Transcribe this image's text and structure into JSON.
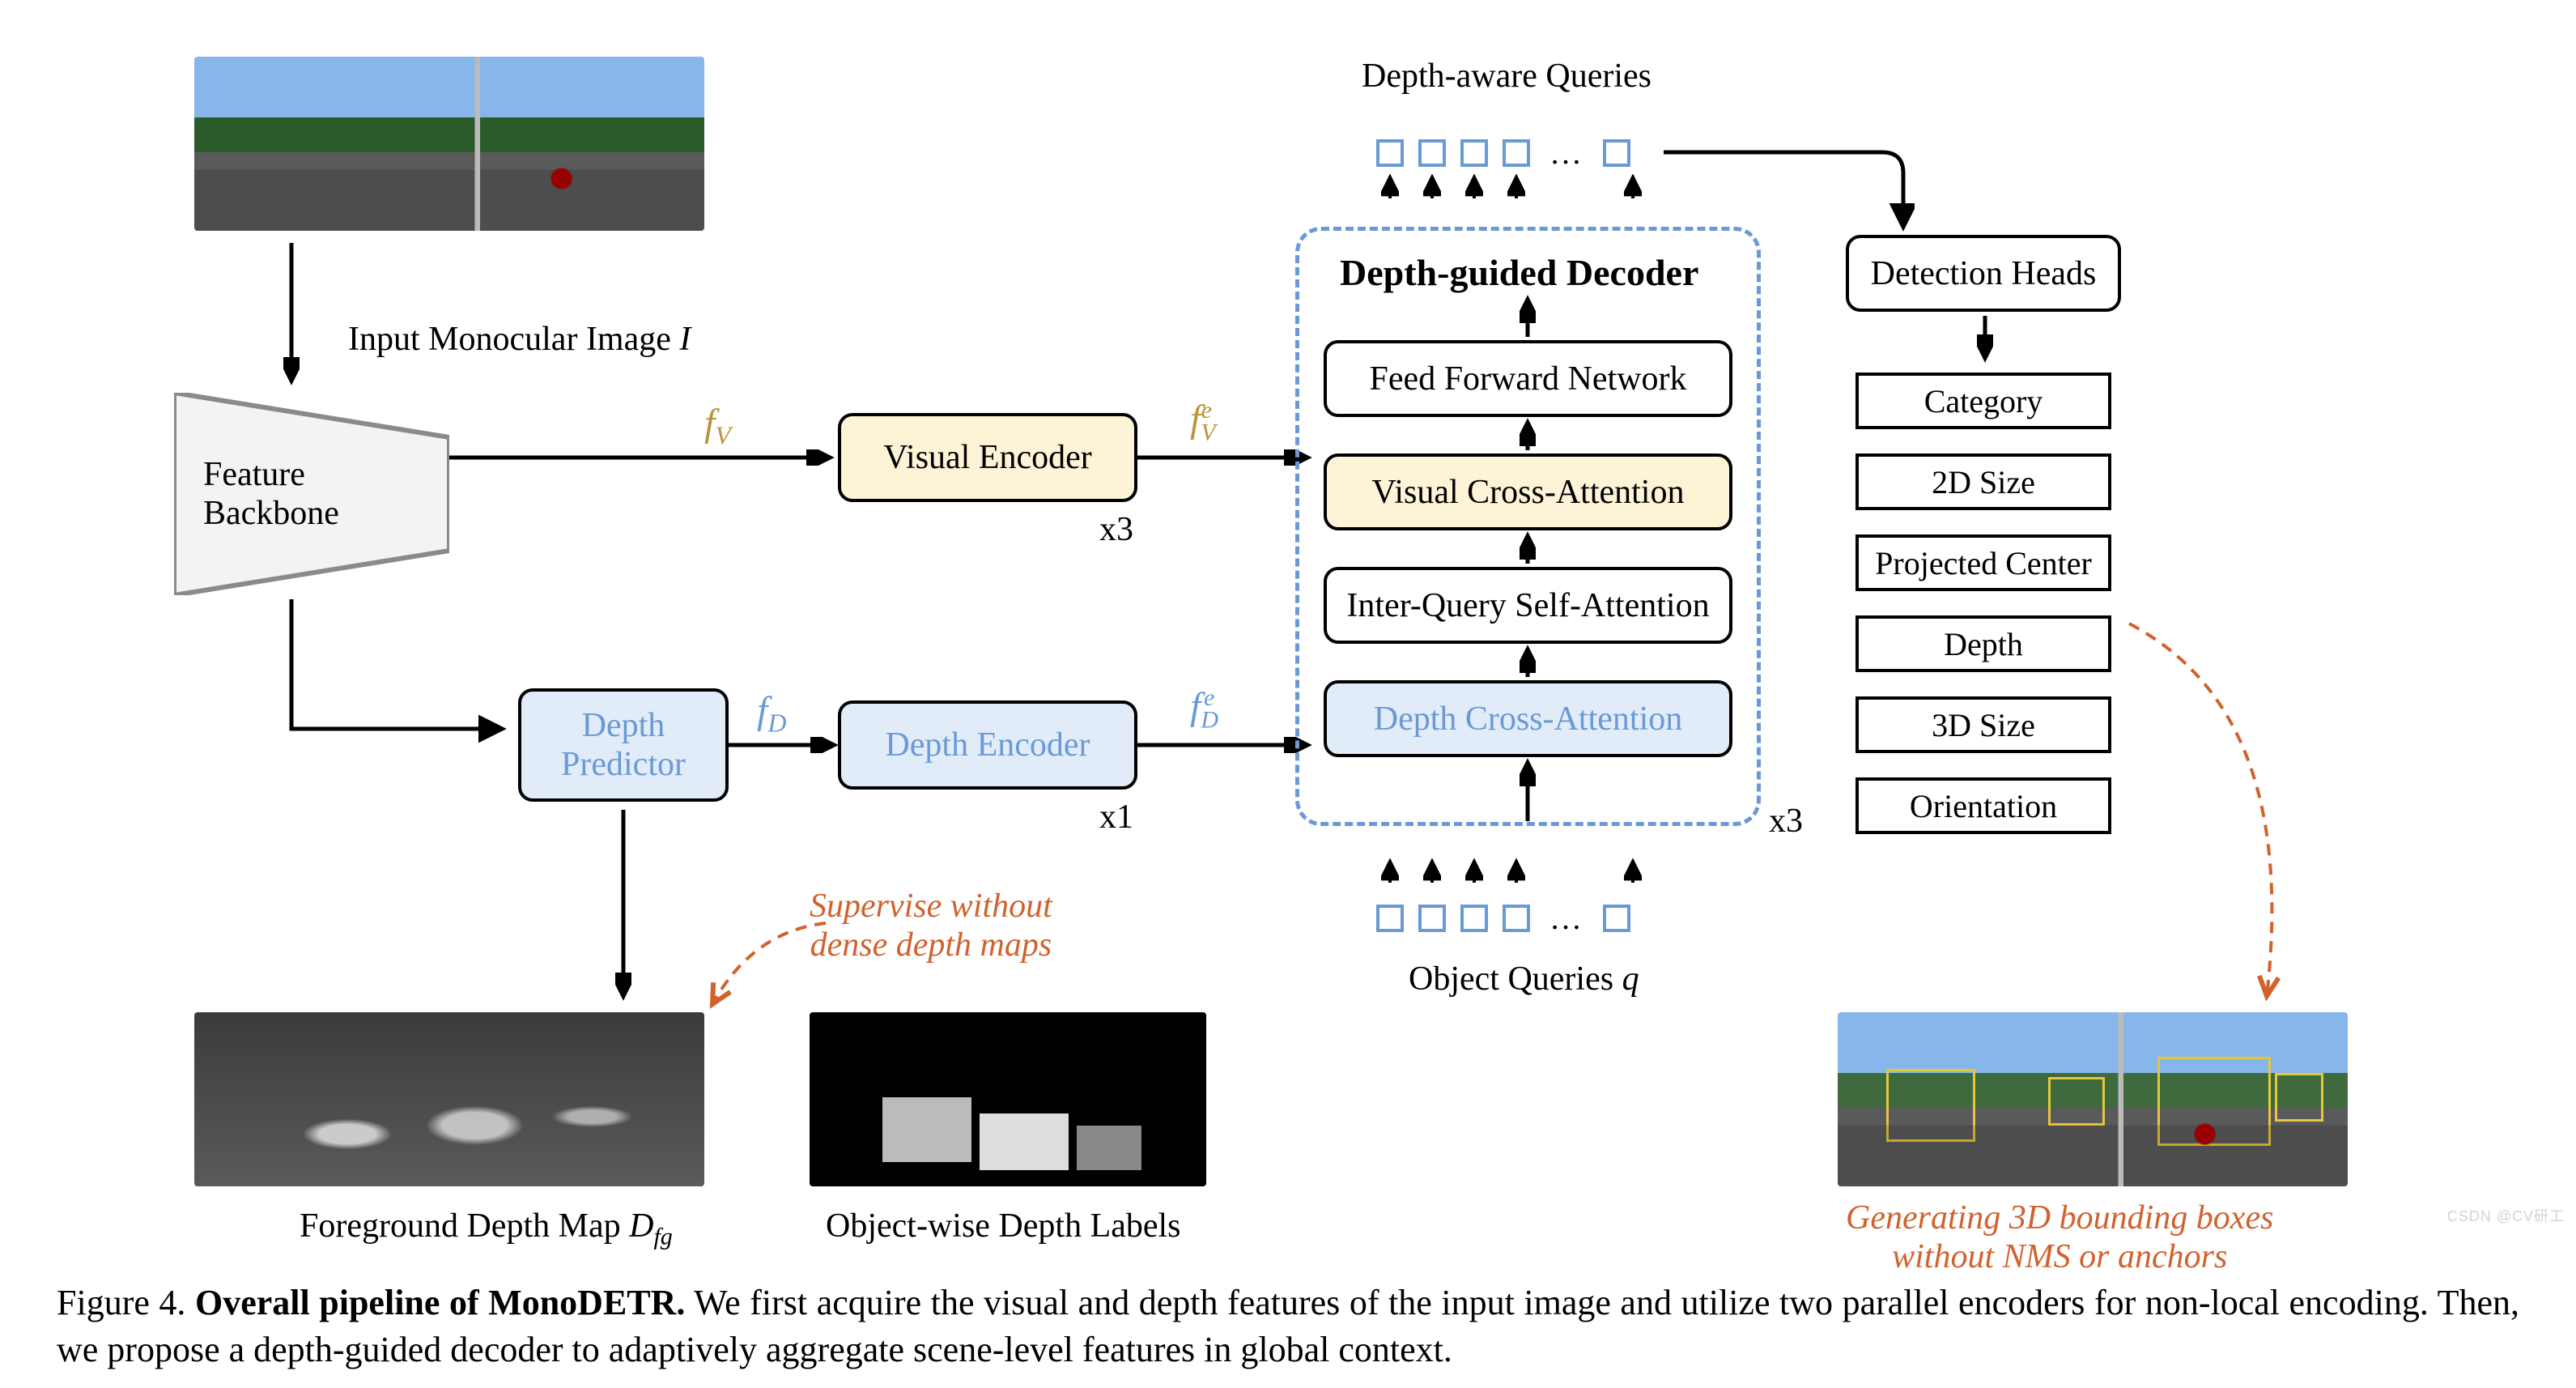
{
  "colors": {
    "accent_blue": "#6a9ad6",
    "accent_yellow": "#b7953c",
    "accent_orange": "#d1622e"
  },
  "images": {
    "input": "street-scene photo",
    "depth_map": "grayscale foreground depth map",
    "depth_labels": "black image with grey rectangular object masks",
    "output": "street-scene with 3D bounding boxes"
  },
  "input_label": {
    "pre": "Input Monocular Image  ",
    "var": "I"
  },
  "backbone": {
    "label": "Feature\nBackbone"
  },
  "depth_predictor": {
    "label": "Depth\nPredictor"
  },
  "visual_encoder": {
    "label": "Visual Encoder",
    "mult": "x3"
  },
  "depth_encoder": {
    "label": "Depth Encoder",
    "mult": "x1"
  },
  "arrows": {
    "fv": "f",
    "fv_sub": "V",
    "fd": "f",
    "fd_sub": "D",
    "fve": "f",
    "fve_sub": "V",
    "fve_sup": "e",
    "fde": "f",
    "fde_sub": "D",
    "fde_sup": "e"
  },
  "decoder": {
    "title": "Depth-guided Decoder",
    "boxes": {
      "ffn": "Feed Forward Network",
      "vca": "Visual Cross-Attention",
      "iqsa": "Inter-Query Self-Attention",
      "dca": "Depth Cross-Attention"
    },
    "mult": "x3"
  },
  "queries": {
    "top": "Depth-aware Queries",
    "bottom_label": {
      "pre": "Object Queries  ",
      "var": "q"
    }
  },
  "detection": {
    "heads": "Detection Heads",
    "items": [
      "Category",
      "2D Size",
      "Projected Center",
      "Depth",
      "3D Size",
      "Orientation"
    ]
  },
  "foreground": {
    "label_pre": "Foreground Depth Map  ",
    "var": "D",
    "sub": "fg"
  },
  "object_labels": "Object-wise Depth Labels",
  "supervise_note": "Supervise without\ndense depth maps",
  "output_note": "Generating 3D bounding boxes\nwithout NMS or anchors",
  "caption": {
    "fig": "Figure 4. ",
    "title": "Overall pipeline of MonoDETR.",
    "body": " We first acquire the visual and depth features of the input image and utilize two parallel encoders for non-local encoding. Then, we propose a depth-guided decoder to adaptively aggregate scene-level features in global context."
  },
  "watermark": "CSDN @CV研工"
}
